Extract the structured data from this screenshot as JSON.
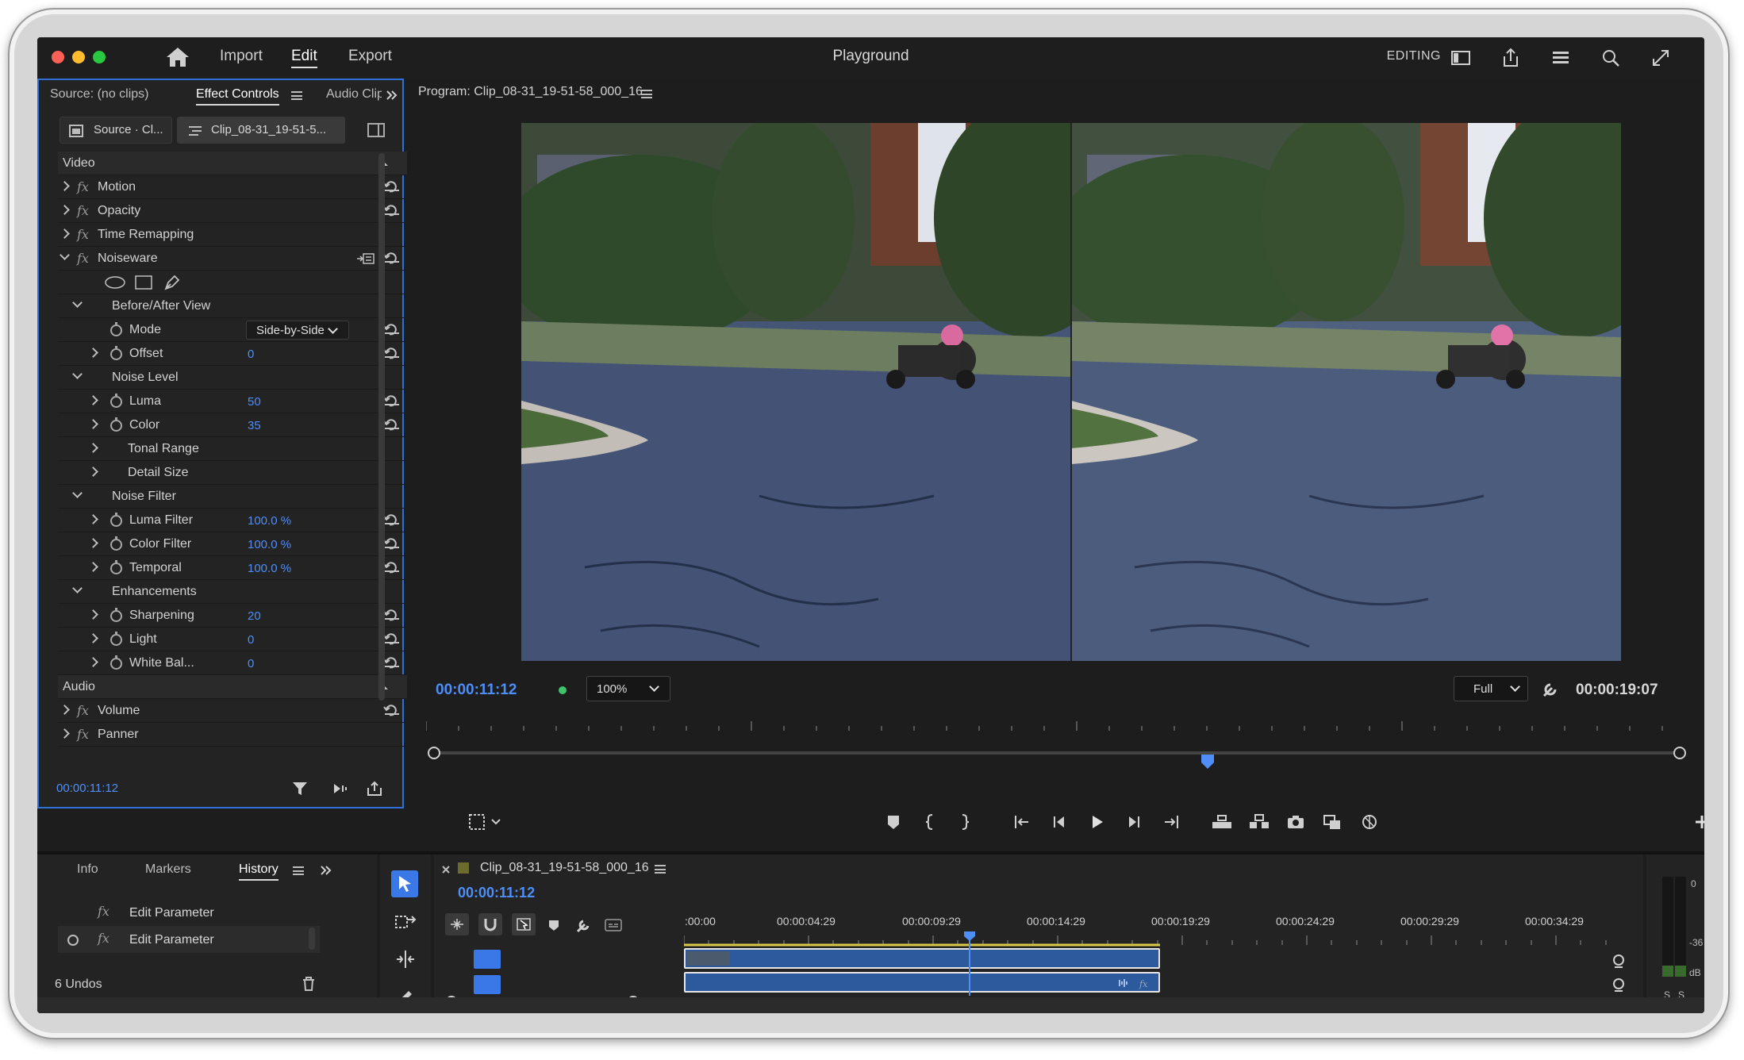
{
  "app": {
    "title": "Playground",
    "menu": [
      "Import",
      "Edit",
      "Export"
    ],
    "active_menu": "Edit",
    "workspace": "EDITING"
  },
  "icons": {
    "home": "home-icon",
    "workspace_panel": "panel-layout-icon",
    "share": "share-icon",
    "quick_actions": "list-icon",
    "search": "search-icon",
    "fullscreen": "expand-icon"
  },
  "colors": {
    "accent": "#4f8ef7",
    "panel_focus": "#2e6fd8",
    "clip": "#2c5a9c",
    "playhead": "#4f8ef7"
  },
  "effect_controls": {
    "tabs": [
      "Source: (no clips)",
      "Effect Controls",
      "Audio Clip"
    ],
    "active_tab": "Effect Controls",
    "source_button": "Source · Cl...",
    "clip_button": "Clip_08-31_19-51-5...",
    "sections": {
      "video": "Video",
      "audio": "Audio"
    },
    "rows": [
      {
        "label": "Motion"
      },
      {
        "label": "Opacity"
      },
      {
        "label": "Time Remapping"
      },
      {
        "label": "Noiseware"
      },
      {
        "label": "Before/After View"
      },
      {
        "label": "Mode",
        "value": "Side-by-Side"
      },
      {
        "label": "Offset",
        "value": "0"
      },
      {
        "label": "Noise Level"
      },
      {
        "label": "Luma",
        "value": "50"
      },
      {
        "label": "Color",
        "value": "35"
      },
      {
        "label": "Tonal Range"
      },
      {
        "label": "Detail Size"
      },
      {
        "label": "Noise Filter"
      },
      {
        "label": "Luma Filter",
        "value": "100.0 %"
      },
      {
        "label": "Color Filter",
        "value": "100.0 %"
      },
      {
        "label": "Temporal",
        "value": "100.0 %"
      },
      {
        "label": "Enhancements"
      },
      {
        "label": "Sharpening",
        "value": "20"
      },
      {
        "label": "Light",
        "value": "0"
      },
      {
        "label": "White Bal...",
        "value": "0"
      },
      {
        "label": "Volume"
      },
      {
        "label": "Panner"
      }
    ],
    "timecode": "00:00:11:12"
  },
  "program": {
    "title": "Program: Clip_08-31_19-51-58_000_16",
    "timecode": "00:00:11:12",
    "zoom": "100%",
    "resolution": "Full",
    "duration": "00:00:19:07",
    "playhead_fraction": 0.59
  },
  "history": {
    "tabs": [
      "Info",
      "Markers",
      "History"
    ],
    "active_tab": "History",
    "items": [
      "Edit Parameter",
      "Edit Parameter"
    ],
    "undos": "6 Undos"
  },
  "timeline": {
    "sequence": "Clip_08-31_19-51-58_000_16",
    "timecode": "00:00:11:12",
    "ruler": [
      ":00:00",
      "00:00:04:29",
      "00:00:09:29",
      "00:00:14:29",
      "00:00:19:29",
      "00:00:24:29",
      "00:00:29:29",
      "00:00:34:29"
    ]
  },
  "meter": {
    "labels": [
      "0",
      "-36",
      "dB"
    ],
    "solo": [
      "S",
      "S"
    ]
  }
}
